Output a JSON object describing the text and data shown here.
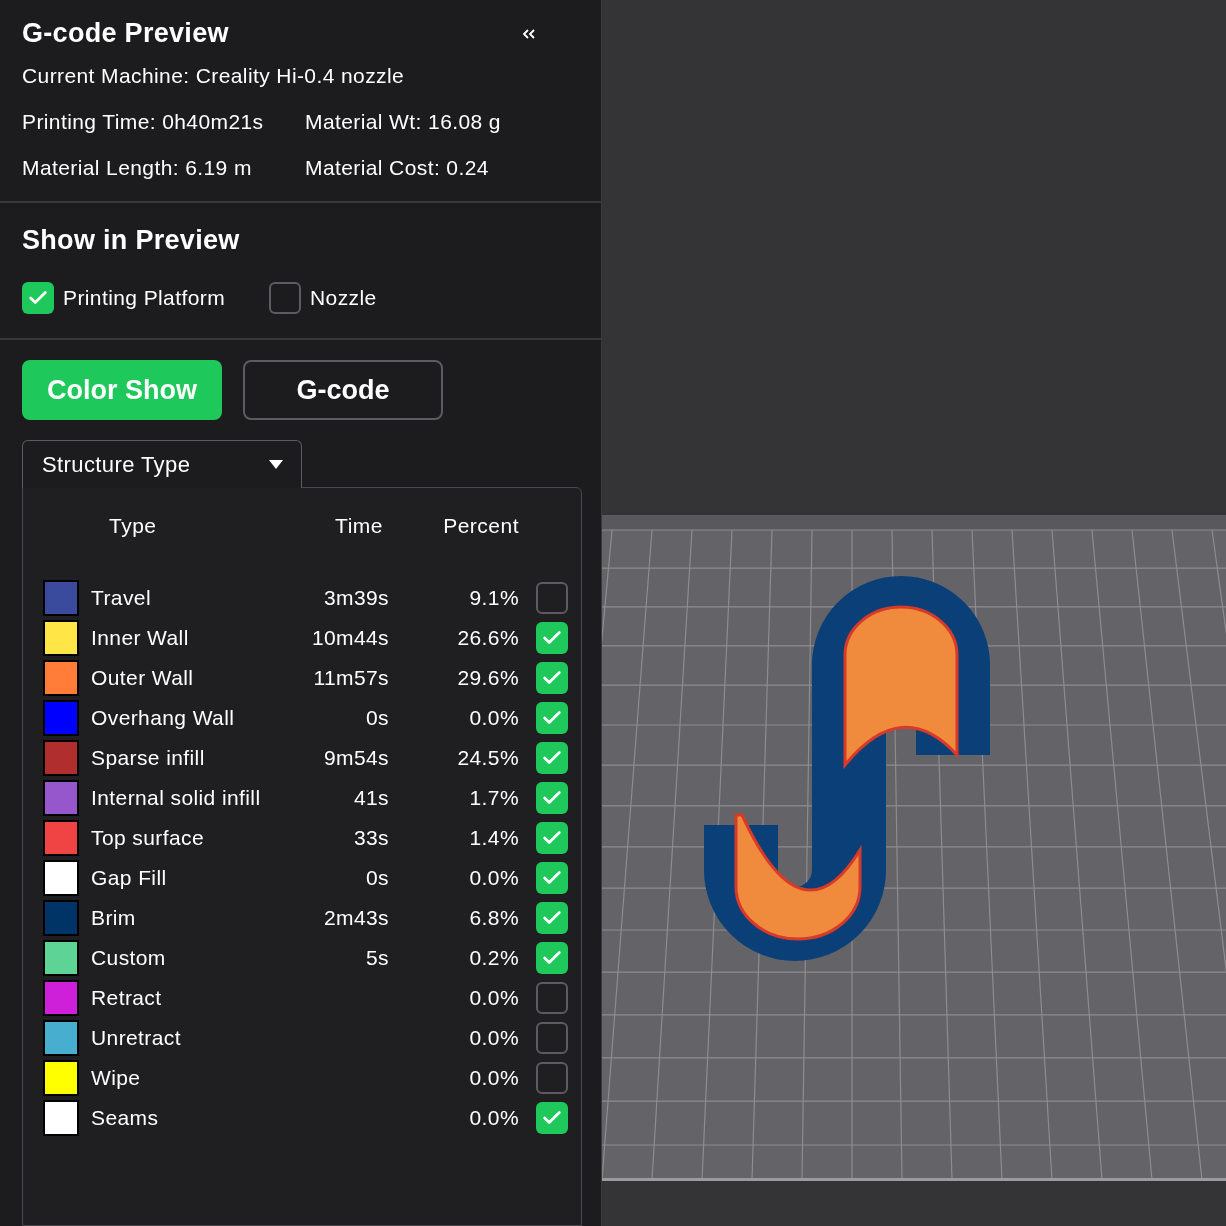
{
  "panel": {
    "title": "G-code Preview",
    "machine": "Current Machine: Creality Hi-0.4 nozzle",
    "stats": [
      "Printing Time: 0h40m21s",
      "Material Wt: 16.08 g",
      "Material Length: 6.19 m",
      "Material Cost: 0.24"
    ]
  },
  "show_in_preview": {
    "title": "Show in Preview",
    "options": [
      {
        "label": "Printing Platform",
        "checked": true
      },
      {
        "label": "Nozzle",
        "checked": false
      }
    ]
  },
  "view_buttons": [
    {
      "label": "Color Show",
      "selected": true
    },
    {
      "label": "G-code",
      "selected": false
    }
  ],
  "dropdown": {
    "value": "Structure Type"
  },
  "legend": {
    "columns": [
      "Type",
      "Time",
      "Percent"
    ],
    "rows": [
      {
        "type": "Travel",
        "time": "3m39s",
        "percent": "9.1%",
        "color": "#3a4a9c",
        "checked": false
      },
      {
        "type": "Inner Wall",
        "time": "10m44s",
        "percent": "26.6%",
        "color": "#ffe545",
        "checked": true
      },
      {
        "type": "Outer Wall",
        "time": "11m57s",
        "percent": "29.6%",
        "color": "#ff7d38",
        "checked": true
      },
      {
        "type": "Overhang Wall",
        "time": "0s",
        "percent": "0.0%",
        "color": "#0000ff",
        "checked": true
      },
      {
        "type": "Sparse infill",
        "time": "9m54s",
        "percent": "24.5%",
        "color": "#b02e2e",
        "checked": true
      },
      {
        "type": "Internal solid infill",
        "time": "41s",
        "percent": "1.7%",
        "color": "#9656cc",
        "checked": true
      },
      {
        "type": "Top surface",
        "time": "33s",
        "percent": "1.4%",
        "color": "#f04444",
        "checked": true
      },
      {
        "type": "Gap Fill",
        "time": "0s",
        "percent": "0.0%",
        "color": "#ffffff",
        "checked": true
      },
      {
        "type": "Brim",
        "time": "2m43s",
        "percent": "6.8%",
        "color": "#003366",
        "checked": true
      },
      {
        "type": "Custom",
        "time": "5s",
        "percent": "0.2%",
        "color": "#5ed396",
        "checked": true
      },
      {
        "type": "Retract",
        "percent": "0.0%",
        "color": "#cd20d8",
        "checked": false
      },
      {
        "type": "Unretract",
        "percent": "0.0%",
        "color": "#48aed0",
        "checked": false
      },
      {
        "type": "Wipe",
        "percent": "0.0%",
        "color": "#ffff00",
        "checked": false
      },
      {
        "type": "Seams",
        "percent": "0.0%",
        "color": "#ffffff",
        "checked": true
      }
    ]
  }
}
